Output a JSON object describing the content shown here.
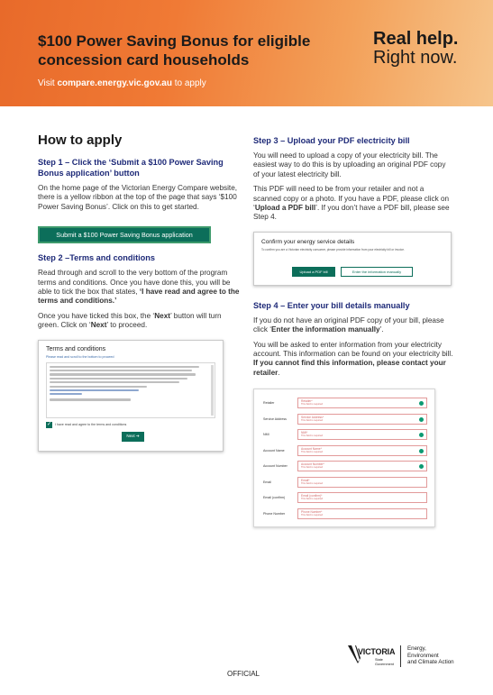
{
  "header": {
    "title": "$100 Power Saving Bonus for eligible concession card households",
    "visit_prefix": "Visit ",
    "visit_url": "compare.energy.vic.gov.au",
    "visit_suffix": " to apply",
    "tagline_1": "Real help.",
    "tagline_2": "Right now."
  },
  "left": {
    "heading": "How to apply",
    "step1": {
      "title": "Step 1 – Click the ‘Submit a $100 Power Saving Bonus application’ button",
      "body": "On the home page of the Victorian Energy Compare website, there is a yellow ribbon at the top of the page that says ‘$100 Power Saving Bonus’. Click on this to get started.",
      "button_label": "Submit a $100 Power Saving Bonus application"
    },
    "step2": {
      "title": "Step 2 –Terms and conditions",
      "body_a": "Read through and scroll to the very bottom of the program terms and conditions. Once you have done this, you will be able to tick the box that states, ",
      "body_a_bold": "‘I have read and agree to the terms and conditions.’",
      "body_b1": "Once you have ticked this box, the ‘",
      "body_b_next1": "Next",
      "body_b2": "’ button will turn green. Click on ‘",
      "body_b_next2": "Next",
      "body_b3": "’ to proceed.",
      "mock": {
        "title": "Terms and conditions",
        "subtitle": "Please read and scroll to the bottom to proceed",
        "agree": "I have read and agree to the terms and conditions",
        "next": "Next ➔"
      }
    }
  },
  "right": {
    "step3": {
      "title": "Step 3 – Upload your PDF electricity bill",
      "body_a": "You will need to upload a copy of your electricity bill. The easiest way to do this is by uploading an original PDF copy of your latest electricity bill.",
      "body_b1": "This PDF will need to be from your retailer and not a scanned copy or a photo. If you have a PDF, please click on ‘",
      "body_b_bold": "Upload a PDF bill",
      "body_b2": "’. If you don’t have a PDF bill, please see Step 4.",
      "mock": {
        "title": "Confirm your energy service details",
        "subtitle": "To confirm you are a Victorian electricity consumer, please provide information from your electricity bill or invoice.",
        "upload": "Upload a PDF bill",
        "manual": "Enter the information manually"
      }
    },
    "step4": {
      "title": "Step 4 – Enter your bill details manually",
      "body_a1": "If you do not have an original PDF copy of your bill, please click ‘",
      "body_a_bold": "Enter the information manually",
      "body_a2": "’.",
      "body_b1": "You will be asked to enter information from your electricity account. This information can be found on your electricity bill. ",
      "body_b_bold": "If you cannot find this information, please contact your retailer",
      "body_b2": ".",
      "form": [
        {
          "label": "Retailer",
          "placeholder": "Retailer*",
          "error": "This field is required",
          "ok": true
        },
        {
          "label": "Service Address",
          "placeholder": "Service Address*",
          "error": "This field is required",
          "ok": true
        },
        {
          "label": "NMI",
          "placeholder": "NMI*",
          "error": "This field is required",
          "ok": true
        },
        {
          "label": "Account Name",
          "placeholder": "Account Name*",
          "error": "This field is required",
          "ok": true
        },
        {
          "label": "Account Number",
          "placeholder": "Account Number*",
          "error": "This field is required",
          "ok": true
        },
        {
          "label": "Email",
          "placeholder": "Email*",
          "error": "This field is required",
          "ok": false
        },
        {
          "label": "Email (confirm)",
          "placeholder": "Email (confirm)*",
          "error": "This field is required",
          "ok": false
        },
        {
          "label": "Phone Number",
          "placeholder": "Phone Number*",
          "error": "This field is required",
          "ok": false
        }
      ]
    }
  },
  "footer": {
    "official": "OFFICIAL",
    "vic_name": "VICTORIA",
    "vic_sub_1": "State",
    "vic_sub_2": "Government",
    "dept_1": "Energy,",
    "dept_2": "Environment",
    "dept_3": "and Climate Action"
  },
  "colors": {
    "header_orange": "#e86a2a",
    "heading_navy": "#1e2a78",
    "button_green": "#0c6e5a",
    "error_red": "#d36a6a"
  }
}
